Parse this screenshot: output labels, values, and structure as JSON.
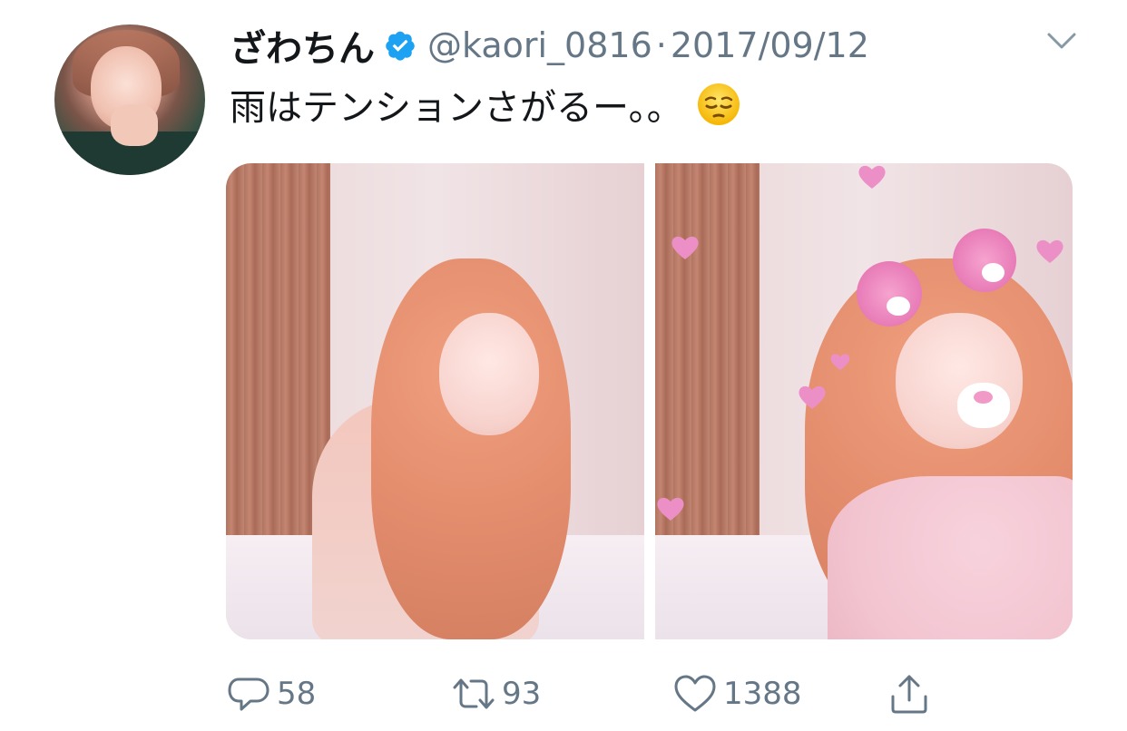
{
  "tweet": {
    "display_name": "ざわちん",
    "handle": "@kaori_0816",
    "separator": "·",
    "date": "2017/09/12",
    "text": "雨はテンションさがるー。。",
    "emoji_icon": "pensive-face-icon",
    "verified_icon": "verified-badge-icon",
    "verified_color": "#1da1f2"
  },
  "actions": {
    "reply_count": "58",
    "retweet_count": "93",
    "like_count": "1388"
  },
  "media": {
    "count": 2
  },
  "colors": {
    "text_primary": "#14171a",
    "text_secondary": "#657786"
  }
}
